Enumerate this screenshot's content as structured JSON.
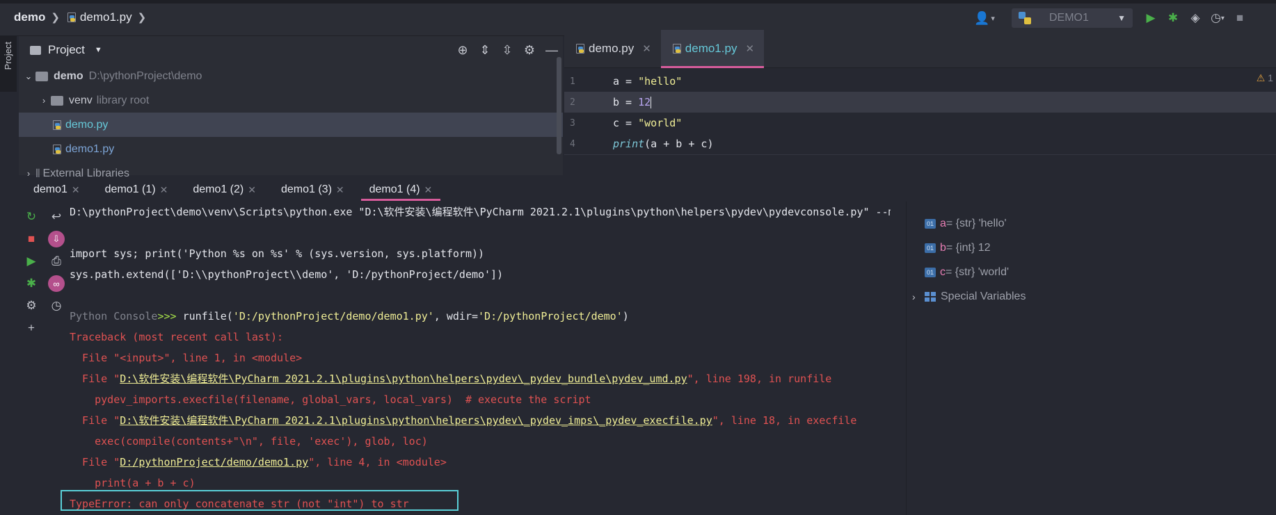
{
  "breadcrumb": {
    "project": "demo",
    "file": "demo1.py"
  },
  "toolbar": {
    "run_config": "DEMO1"
  },
  "project_panel": {
    "title": "Project",
    "strip_label": "Project",
    "tree": [
      {
        "name": "demo",
        "path": "D:\\pythonProject\\demo"
      },
      {
        "name": "venv",
        "suffix": "library root"
      },
      {
        "name": "demo.py"
      },
      {
        "name": "demo1.py"
      },
      {
        "name": "External Libraries"
      }
    ]
  },
  "editor": {
    "tabs": [
      {
        "label": "demo.py"
      },
      {
        "label": "demo1.py"
      }
    ],
    "line_numbers": [
      "1",
      "2",
      "3",
      "4"
    ],
    "warning_count": "1",
    "code": {
      "l1_var": "a",
      "l1_op": " = ",
      "l1_val": "\"hello\"",
      "l2_var": "b",
      "l2_op": " = ",
      "l2_val": "12",
      "l3_var": "c",
      "l3_op": " = ",
      "l3_val": "\"world\"",
      "l4_fn": "print",
      "l4_rest": "(a + b + c)"
    }
  },
  "console_tabs": [
    "demo1",
    "demo1 (1)",
    "demo1 (2)",
    "demo1 (3)",
    "demo1 (4)"
  ],
  "console": {
    "cmd": "D:\\pythonProject\\demo\\venv\\Scripts\\python.exe \"D:\\软件安装\\编程软件\\PyCharm 2021.2.1\\plugins\\python\\helpers\\pydev\\pydevconsole.py\" --m",
    "import_line": "import sys; print('Python %s on %s' % (sys.version, sys.platform))",
    "extend_line": "sys.path.extend(['D:\\\\pythonProject\\\\demo', 'D:/pythonProject/demo'])",
    "prompt_label": "Python Console",
    "prompt_arrows": ">>> ",
    "runfile_a": "runfile(",
    "runfile_b": "'D:/pythonProject/demo/demo1.py'",
    "runfile_c": ", wdir=",
    "runfile_d": "'D:/pythonProject/demo'",
    "runfile_e": ")",
    "traceback": "Traceback (most recent call last):",
    "f1": "  File \"<input>\", line 1, in <module>",
    "f2_pre": "  File \"",
    "f2_link": "D:\\软件安装\\编程软件\\PyCharm 2021.2.1\\plugins\\python\\helpers\\pydev\\_pydev_bundle\\pydev_umd.py",
    "f2_post": "\", line 198, in runfile",
    "f2_code": "    pydev_imports.execfile(filename, global_vars, local_vars)  # execute the script",
    "f3_pre": "  File \"",
    "f3_link": "D:\\软件安装\\编程软件\\PyCharm 2021.2.1\\plugins\\python\\helpers\\pydev\\_pydev_imps\\_pydev_execfile.py",
    "f3_post": "\", line 18, in execfile",
    "f3_code": "    exec(compile(contents+\"\\n\", file, 'exec'), glob, loc)",
    "f4_pre": "  File \"",
    "f4_link": "D:/pythonProject/demo/demo1.py",
    "f4_post": "\", line 4, in <module>",
    "f4_code": "    print(a + b + c)",
    "error": "TypeError: can only concatenate str (not \"int\") to str"
  },
  "variables": [
    {
      "name": "a",
      "value": " = {str} 'hello'"
    },
    {
      "name": "b",
      "value": " = {int} 12"
    },
    {
      "name": "c",
      "value": " = {str} 'world'"
    }
  ],
  "special_variables": "Special Variables",
  "colors": {
    "accent_pink": "#d65c9b",
    "error_red": "#e05252",
    "string_yellow": "#f0ee96",
    "highlight_box": "#5ad0d8"
  }
}
